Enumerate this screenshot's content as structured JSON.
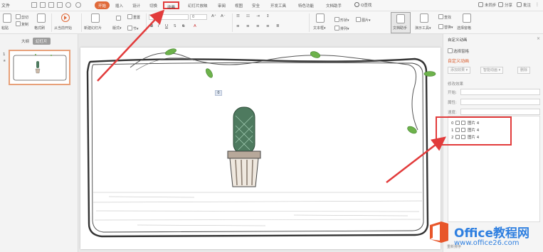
{
  "menubar": {
    "file_label": "文件",
    "tabs": [
      "开始",
      "插入",
      "设计",
      "切换",
      "动画",
      "幻灯片放映",
      "审阅",
      "视图",
      "安全",
      "开发工具",
      "特色功能",
      "文档助手"
    ],
    "active_tab": "开始",
    "highlighted_tab": "动画",
    "search_label": "Q查找",
    "right_tools": [
      "未同步",
      "分享",
      "批注"
    ]
  },
  "ribbon": {
    "paste": "粘贴",
    "cut": "剪切",
    "copy": "复制",
    "format_painter": "格式刷",
    "play_from_current": "从当前开始",
    "new_slide": "新建幻灯片",
    "layout": "版式",
    "section": "节",
    "reset": "重置",
    "font_size": "0",
    "text_box": "文本框",
    "shape": "形状",
    "arrange": "排列",
    "picture": "图片",
    "find": "查找",
    "replace": "替换",
    "select_pane": "选择窗格",
    "doc_helper": "文档助手",
    "slide_show_btn": "演示工具"
  },
  "left_panel": {
    "tab_outline": "大纲",
    "tab_slides": "幻灯片",
    "slide_number": "1",
    "slide_marker": "★"
  },
  "canvas": {
    "selection_tag": "0"
  },
  "task_pane": {
    "title": "自定义动画",
    "select_pane": "选择窗格",
    "custom_animation": "自定义动画",
    "add_effect": "添加效果",
    "smart_animation": "智能动画",
    "delete": "删除",
    "modify_effect": "修改效果",
    "start_label": "开始:",
    "property_label": "属性:",
    "speed_label": "速度:",
    "animations": [
      {
        "order": "0",
        "name": "图片 4"
      },
      {
        "order": "1",
        "name": "图片 4"
      },
      {
        "order": "2",
        "name": "图片 4"
      }
    ],
    "bottom_label": "重新排序"
  },
  "watermark": {
    "title": "Office教程网",
    "url": "www.office26.com"
  },
  "colors": {
    "accent": "#e06a3a",
    "highlight_red": "#e23b3b",
    "watermark_blue": "#2e7fe0",
    "watermark_orange": "#e8562a"
  }
}
